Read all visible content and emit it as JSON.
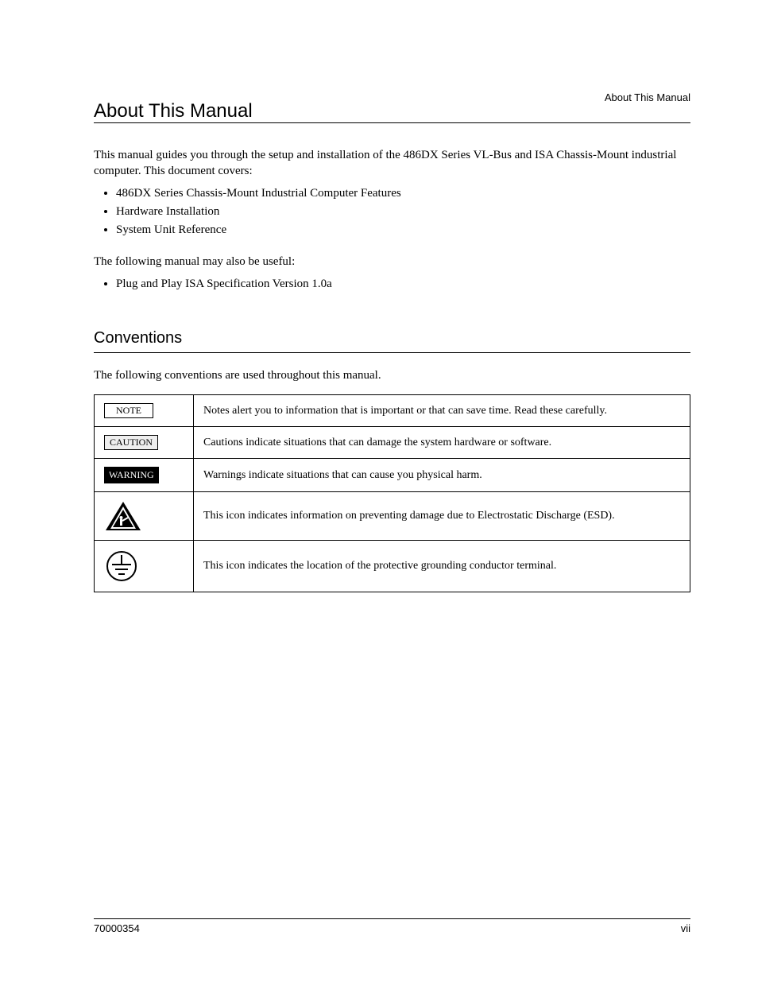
{
  "running_head": "About This Manual",
  "title": "About This Manual",
  "intro": "This manual guides you through the setup and installation of the 486DX Series VL-Bus and ISA Chassis-Mount industrial computer. This document covers:",
  "bullets": [
    "486DX Series Chassis-Mount Industrial Computer Features",
    "Hardware Installation",
    "System Unit Reference"
  ],
  "related_text": "The following manual may also be useful:",
  "related_bullets": [
    "Plug and Play ISA Specification Version 1.0a"
  ],
  "section_conventions": "Conventions",
  "conventions_intro": "The following conventions are used throughout this manual.",
  "rows": [
    {
      "symbol_label": "NOTE",
      "desc": "Notes alert you to information that is important or that can save time. Read these carefully.",
      "kind": "note"
    },
    {
      "symbol_label": "CAUTION",
      "desc": "Cautions indicate situations that can damage the system hardware or software.",
      "kind": "caution"
    },
    {
      "symbol_label": "WARNING",
      "desc": "Warnings indicate situations that can cause you physical harm.",
      "kind": "warning"
    },
    {
      "symbol_label": "esd-icon",
      "desc": "This icon indicates information on preventing damage due to Electrostatic Discharge (ESD).",
      "kind": "esd"
    },
    {
      "symbol_label": "ground-icon",
      "desc": "This icon indicates the location of the protective grounding conductor terminal.",
      "kind": "ground"
    }
  ],
  "footer_left": "70000354",
  "footer_right": "vii"
}
